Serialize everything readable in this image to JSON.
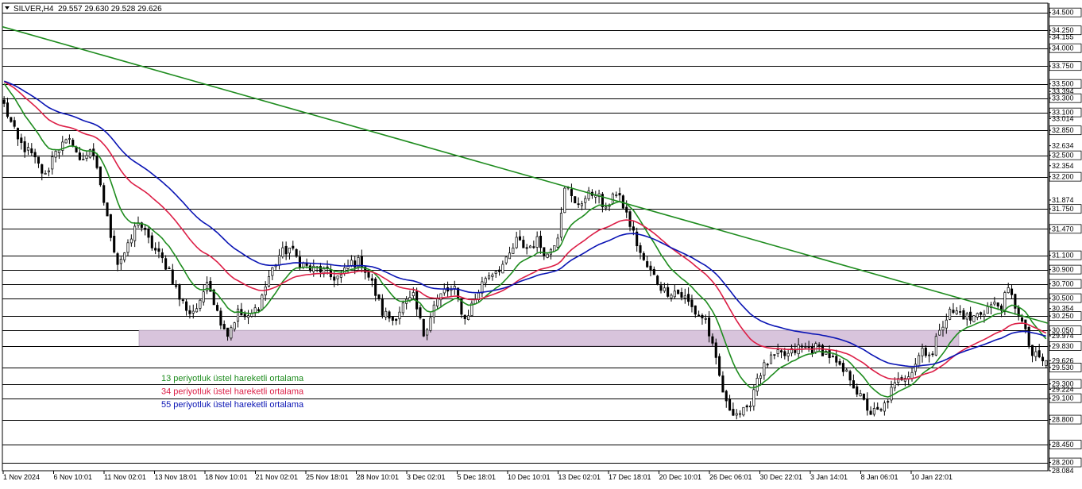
{
  "header": {
    "menu_icon": "triangle-down-icon",
    "symbol_label": "SILVER,H4",
    "ohlc_text": "29.557 29.630 29.528 29.626"
  },
  "chart_data": {
    "type": "candlestick",
    "symbol": "SILVER",
    "timeframe": "H4",
    "ohlc": {
      "open": 29.557,
      "high": 29.63,
      "low": 29.528,
      "close": 29.626
    },
    "ylim": [
      28.084,
      34.63
    ],
    "price_tick_labels": [
      "34.500",
      "34.250",
      "34.155",
      "34.000",
      "33.750",
      "33.500",
      "33.394",
      "33.300",
      "33.100",
      "33.014",
      "32.850",
      "32.634",
      "32.500",
      "32.354",
      "32.200",
      "31.874",
      "31.750",
      "31.470",
      "31.100",
      "30.900",
      "30.700",
      "30.500",
      "30.354",
      "30.250",
      "30.050",
      "29.974",
      "29.830",
      "29.626",
      "29.530",
      "29.300",
      "29.224",
      "29.100",
      "28.800",
      "28.450",
      "28.200",
      "28.084"
    ],
    "horizontal_levels": [
      34.5,
      34.25,
      34.0,
      33.75,
      33.5,
      33.3,
      33.1,
      32.85,
      32.5,
      32.2,
      31.75,
      31.47,
      31.1,
      30.9,
      30.7,
      30.5,
      30.25,
      30.05,
      29.83,
      29.53,
      29.3,
      29.1,
      28.8,
      28.45,
      28.2
    ],
    "x_tick_labels": [
      "1 Nov 2024",
      "6 Nov 10:01",
      "11 Nov 02:01",
      "13 Nov 18:01",
      "18 Nov 10:01",
      "21 Nov 02:01",
      "25 Nov 18:01",
      "28 Nov 10:01",
      "3 Dec 02:01",
      "5 Dec 18:01",
      "10 Dec 10:01",
      "13 Dec 02:01",
      "17 Dec 18:01",
      "20 Dec 10:01",
      "26 Dec 06:01",
      "30 Dec 22:01",
      "3 Jan 14:01",
      "8 Jan 06:01",
      "10 Jan 22:01"
    ],
    "support_zone": {
      "low": 29.83,
      "high": 30.05,
      "color": "#d8c4dc"
    },
    "trendline": {
      "color": "#1f8c1f",
      "start_price": 34.3,
      "end_price": 30.15
    },
    "legend": [
      {
        "label": "13 periyotluk üstel hareketli ortalama",
        "color": "#1e8c1e"
      },
      {
        "label": "34 periyotluk üstel hareketli ortalama",
        "color": "#dc1e46"
      },
      {
        "label": "55 periyotluk üstel hareketli ortalama",
        "color": "#0a14b4"
      }
    ],
    "price_anchors": [
      [
        0,
        33.2
      ],
      [
        4,
        32.7
      ],
      [
        8,
        32.5
      ],
      [
        12,
        32.2
      ],
      [
        15,
        32.6
      ],
      [
        20,
        32.7
      ],
      [
        22,
        32.4
      ],
      [
        25,
        32.6
      ],
      [
        28,
        32.1
      ],
      [
        30,
        31.6
      ],
      [
        33,
        31.0
      ],
      [
        36,
        31.2
      ],
      [
        39,
        31.6
      ],
      [
        42,
        31.3
      ],
      [
        45,
        31.1
      ],
      [
        48,
        30.9
      ],
      [
        51,
        30.5
      ],
      [
        54,
        30.3
      ],
      [
        57,
        30.4
      ],
      [
        59,
        30.8
      ],
      [
        62,
        30.3
      ],
      [
        65,
        30.0
      ],
      [
        68,
        30.3
      ],
      [
        71,
        30.2
      ],
      [
        74,
        30.4
      ],
      [
        77,
        30.8
      ],
      [
        80,
        31.1
      ],
      [
        83,
        31.2
      ],
      [
        86,
        31.0
      ],
      [
        89,
        30.9
      ],
      [
        92,
        30.9
      ],
      [
        95,
        30.8
      ],
      [
        98,
        30.8
      ],
      [
        101,
        31.0
      ],
      [
        104,
        31.0
      ],
      [
        107,
        30.7
      ],
      [
        110,
        30.3
      ],
      [
        113,
        30.2
      ],
      [
        116,
        30.4
      ],
      [
        119,
        30.5
      ],
      [
        122,
        30.0
      ],
      [
        125,
        30.4
      ],
      [
        128,
        30.6
      ],
      [
        131,
        30.6
      ],
      [
        134,
        30.2
      ],
      [
        137,
        30.5
      ],
      [
        140,
        30.8
      ],
      [
        143,
        30.9
      ],
      [
        146,
        31.0
      ],
      [
        149,
        31.3
      ],
      [
        152,
        31.2
      ],
      [
        155,
        31.3
      ],
      [
        158,
        31.1
      ],
      [
        161,
        31.4
      ],
      [
        163,
        32.1
      ],
      [
        166,
        31.8
      ],
      [
        169,
        31.9
      ],
      [
        172,
        32.0
      ],
      [
        175,
        31.7
      ],
      [
        177,
        32.0
      ],
      [
        180,
        31.8
      ],
      [
        183,
        31.4
      ],
      [
        186,
        31.0
      ],
      [
        189,
        30.8
      ],
      [
        192,
        30.6
      ],
      [
        195,
        30.6
      ],
      [
        198,
        30.5
      ],
      [
        201,
        30.3
      ],
      [
        204,
        30.2
      ],
      [
        207,
        29.6
      ],
      [
        210,
        29.0
      ],
      [
        213,
        28.9
      ],
      [
        216,
        28.9
      ],
      [
        219,
        29.4
      ],
      [
        222,
        29.6
      ],
      [
        225,
        29.7
      ],
      [
        228,
        29.7
      ],
      [
        231,
        29.8
      ],
      [
        234,
        29.8
      ],
      [
        237,
        29.8
      ],
      [
        240,
        29.7
      ],
      [
        243,
        29.5
      ],
      [
        246,
        29.4
      ],
      [
        249,
        29.1
      ],
      [
        252,
        28.9
      ],
      [
        255,
        28.9
      ],
      [
        258,
        29.2
      ],
      [
        261,
        29.4
      ],
      [
        264,
        29.5
      ],
      [
        267,
        29.8
      ],
      [
        270,
        29.7
      ],
      [
        272,
        30.1
      ],
      [
        275,
        30.3
      ],
      [
        278,
        30.3
      ],
      [
        281,
        30.2
      ],
      [
        284,
        30.3
      ],
      [
        287,
        30.4
      ],
      [
        290,
        30.4
      ],
      [
        292,
        30.6
      ],
      [
        295,
        30.3
      ],
      [
        297,
        30.0
      ],
      [
        299,
        29.7
      ],
      [
        303,
        29.6
      ]
    ],
    "series": [
      {
        "name": "13 periyotluk üstel hareketli ortalama",
        "period": 13,
        "color": "#1e8c1e"
      },
      {
        "name": "34 periyotluk üstel hareketli ortalama",
        "period": 34,
        "color": "#dc1e46"
      },
      {
        "name": "55 periyotluk üstel hareketli ortalama",
        "period": 55,
        "color": "#0a14b4"
      }
    ]
  }
}
